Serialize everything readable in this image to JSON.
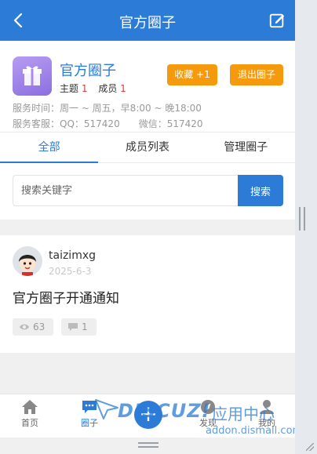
{
  "topbar": {
    "title": "官方圈子",
    "back_icon": "chevron-left-icon",
    "edit_icon": "edit-icon"
  },
  "group": {
    "name": "官方圈子",
    "topics_label": "主题",
    "topics_count": "1",
    "members_label": "成员",
    "members_count": "1",
    "favorite_button": "收藏 +1",
    "quit_button": "退出圈子",
    "service_hours": "服务时间：周一 ~ 周五，早8:00 ~ 晚18:00",
    "service_contact": "服务客服：QQ：517420　　微信：517420"
  },
  "tabs": [
    {
      "label": "全部",
      "active": true
    },
    {
      "label": "成员列表",
      "active": false
    },
    {
      "label": "管理圈子",
      "active": false
    }
  ],
  "search": {
    "placeholder": "搜索关键字",
    "button": "搜索"
  },
  "post": {
    "author": "taizimxg",
    "date": "2025-6-3",
    "title": "官方圈子开通通知",
    "views": "63",
    "replies": "1"
  },
  "bottom_nav": [
    {
      "label": "首页",
      "icon": "home-icon"
    },
    {
      "label": "圈子",
      "icon": "chat-icon"
    },
    {
      "label": "",
      "icon": "plus-icon"
    },
    {
      "label": "发现",
      "icon": "compass-icon"
    },
    {
      "label": "我的",
      "icon": "user-icon"
    }
  ],
  "watermark": {
    "brand": "DISCUZ!",
    "cn": "应用中心",
    "url": "addon.dismall.com"
  },
  "colors": {
    "primary": "#2c7bd6",
    "orange": "#f59a0c",
    "accent_red": "#e53935"
  }
}
